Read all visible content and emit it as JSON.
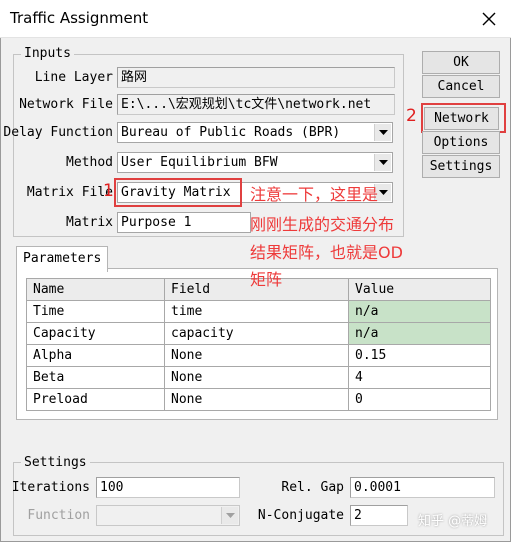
{
  "window": {
    "title": "Traffic Assignment"
  },
  "inputs": {
    "group_label": "Inputs",
    "line_layer_label": "Line Layer",
    "line_layer_value": "路网",
    "network_file_label": "Network File",
    "network_file_value": "E:\\...\\宏观规划\\tc文件\\network.net",
    "delay_function_label": "Delay Function",
    "delay_function_value": "Bureau of Public Roads (BPR)",
    "method_label": "Method",
    "method_value": "User Equilibrium BFW",
    "matrix_file_label": "Matrix File",
    "matrix_file_value": "Gravity Matrix",
    "matrix_label": "Matrix",
    "matrix_value": "Purpose 1"
  },
  "buttons": {
    "ok": "OK",
    "cancel": "Cancel",
    "network": "Network",
    "options": "Options",
    "settings": "Settings"
  },
  "annotations": {
    "num1": "1",
    "num2": "2",
    "note_line1": "注意一下，这里是",
    "note_line2": "刚刚生成的交通分布",
    "note_line3": "结果矩阵，也就是OD",
    "note_line4": "矩阵",
    "color": "#ee3a3a"
  },
  "parameters": {
    "tab_label": "Parameters",
    "columns": [
      "Name",
      "Field",
      "Value"
    ],
    "rows": [
      {
        "name": "Time",
        "field": "time",
        "value": "n/a"
      },
      {
        "name": "Capacity",
        "field": "capacity",
        "value": "n/a"
      },
      {
        "name": "Alpha",
        "field": "None",
        "value": "0.15"
      },
      {
        "name": "Beta",
        "field": "None",
        "value": "4"
      },
      {
        "name": "Preload",
        "field": "None",
        "value": "0"
      }
    ]
  },
  "settings": {
    "group_label": "Settings",
    "iterations_label": "Iterations",
    "iterations_value": "100",
    "rel_gap_label": "Rel. Gap",
    "rel_gap_value": "0.0001",
    "function_label": "Function",
    "function_value": "",
    "n_conjugate_label": "N-Conjugate",
    "n_conjugate_value": "2"
  },
  "watermark": "知乎 @蒂姆"
}
